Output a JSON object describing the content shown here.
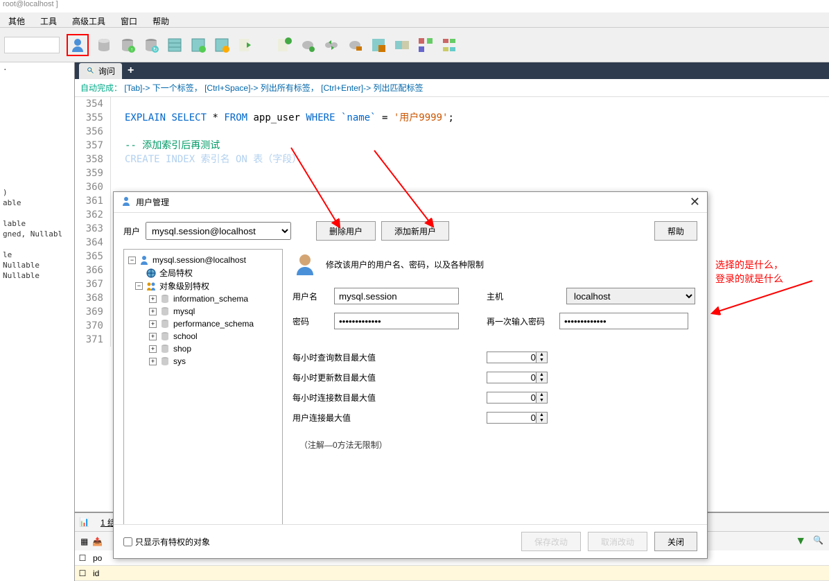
{
  "title_bar": "root@localhost ]",
  "menu": [
    "其他",
    "工具",
    "高级工具",
    "窗口",
    "帮助"
  ],
  "query_tab": "询问",
  "hint": {
    "label": "自动完成：",
    "parts": [
      "[Tab]-> 下一个标签，",
      "[Ctrl+Space]-> 列出所有标签，",
      "[Ctrl+Enter]-> 列出匹配标签"
    ]
  },
  "code": {
    "lines": [
      354,
      355,
      356,
      357,
      358,
      359,
      360,
      361,
      362,
      363,
      364,
      365,
      366,
      367,
      368,
      369,
      370,
      371
    ],
    "sql_explain": "EXPLAIN",
    "sql_select": "SELECT",
    "sql_star": "*",
    "sql_from": "FROM",
    "sql_table": "app_user",
    "sql_where": "WHERE",
    "sql_col": "`name`",
    "sql_eq": "=",
    "sql_str": "'用户9999'",
    "sql_semi": ";",
    "comment": "-- 添加索引后再测试",
    "create_partial": "CREATE INDEX 索引名 ON 表（字段）"
  },
  "left_items": [
    ".",
    "",
    "",
    "",
    "",
    "",
    "",
    "",
    "",
    "",
    "",
    "",
    ")",
    "able",
    "",
    "lable",
    "gned, Nullabl",
    "",
    "le",
    "Nullable",
    " Nullable"
  ],
  "bottom_tab": "1 结",
  "bottom_cols": [
    "po",
    "id"
  ],
  "dialog": {
    "title": "用户管理",
    "user_label": "用户",
    "user_select": "mysql.session@localhost",
    "delete_btn": "删除用户",
    "add_btn": "添加新用户",
    "help_btn": "帮助",
    "tree": {
      "root": "mysql.session@localhost",
      "global": "全局特权",
      "object": "对象级别特权",
      "dbs": [
        "information_schema",
        "mysql",
        "performance_schema",
        "school",
        "shop",
        "sys"
      ]
    },
    "form": {
      "header_text": "修改该用户的用户名、密码，以及各种限制",
      "username_label": "用户名",
      "username_val": "mysql.session",
      "host_label": "主机",
      "host_val": "localhost",
      "password_label": "密码",
      "password_val": "•••••••••••••",
      "password2_label": "再一次输入密码",
      "password2_val": "•••••••••••••",
      "limit1": "每小时查询数目最大值",
      "limit2": "每小时更新数目最大值",
      "limit3": "每小时连接数目最大值",
      "limit4": "用户连接最大值",
      "limit_val": "0",
      "note": "（注解—0方法无限制）"
    },
    "footer": {
      "checkbox": "只显示有特权的对象",
      "save_btn": "保存改动",
      "cancel_btn": "取消改动",
      "close_btn": "关闭"
    }
  },
  "annotation": {
    "line1": "选择的是什么，",
    "line2": "登录的就是什么"
  }
}
